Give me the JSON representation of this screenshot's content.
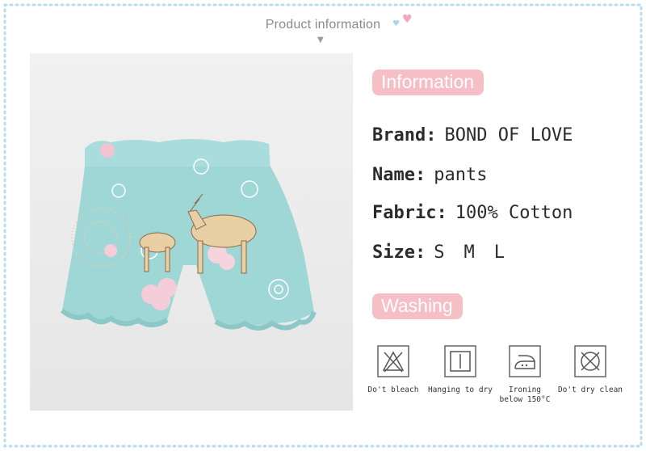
{
  "header": {
    "title": "Product information"
  },
  "info_section": {
    "badge": "Information",
    "rows": [
      {
        "label": "Brand:",
        "value": "BOND OF LOVE"
      },
      {
        "label": "Name:",
        "value": "pants"
      },
      {
        "label": "Fabric:",
        "value": "100% Cotton"
      },
      {
        "label": "Size:",
        "sizes": [
          "S",
          "M",
          "L"
        ]
      }
    ]
  },
  "washing_section": {
    "badge": "Washing",
    "care": [
      {
        "icon": "no-bleach-icon",
        "label": "Do't bleach"
      },
      {
        "icon": "hang-dry-icon",
        "label": "Hanging to dry"
      },
      {
        "icon": "iron-icon",
        "label_lines": [
          "Ironing",
          "below 150°C"
        ]
      },
      {
        "icon": "no-dry-clean-icon",
        "label": "Do't dry clean"
      }
    ]
  },
  "colors": {
    "accent_pink": "#f6bfc6",
    "border_blue": "#a9d4ee",
    "shorts_teal": "#9fd6d6"
  }
}
